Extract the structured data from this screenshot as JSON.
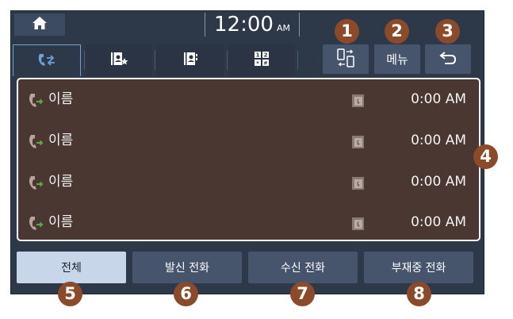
{
  "status_bar": {
    "time": "12:00",
    "ampm": "AM"
  },
  "tabs": [
    {
      "icon": "call-log-icon",
      "active": true
    },
    {
      "icon": "favorites-icon"
    },
    {
      "icon": "contacts-icon"
    },
    {
      "icon": "keypad-icon"
    }
  ],
  "actions": {
    "switch_icon": "phone-switch-icon",
    "menu_label": "메뉴",
    "back_icon": "back-arrow-icon"
  },
  "call_log": [
    {
      "name": "이름",
      "time": "0:00 AM",
      "call_icon": "outgoing-call-icon",
      "type_icon": "mobile-icon"
    },
    {
      "name": "이름",
      "time": "0:00 AM",
      "call_icon": "outgoing-call-icon",
      "type_icon": "mobile-icon"
    },
    {
      "name": "이름",
      "time": "0:00 AM",
      "call_icon": "outgoing-call-icon",
      "type_icon": "mobile-icon"
    },
    {
      "name": "이름",
      "time": "0:00 AM",
      "call_icon": "outgoing-call-icon",
      "type_icon": "mobile-icon"
    }
  ],
  "filters": [
    {
      "label": "전체",
      "selected": true
    },
    {
      "label": "발신 전화"
    },
    {
      "label": "수신 전화"
    },
    {
      "label": "부재중 전화"
    }
  ],
  "callouts": [
    "1",
    "2",
    "3",
    "4",
    "5",
    "6",
    "7",
    "8"
  ],
  "colors": {
    "background": "#2d3848",
    "button": "#46546c",
    "list_background": "#4a3731",
    "selected_filter": "#c8d6ea",
    "callout": "#8b4a2a",
    "call_icon_green": "#5fa54a"
  }
}
